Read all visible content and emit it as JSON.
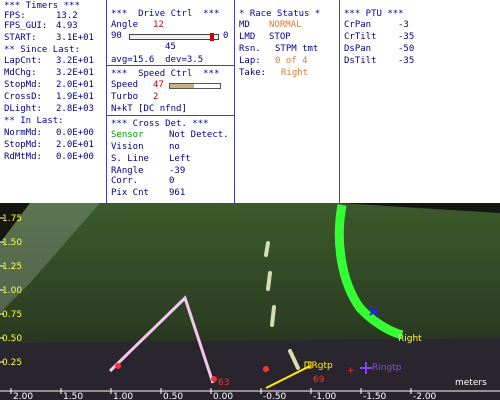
{
  "timers": {
    "title": "*** Timers ***",
    "fps_label": "FPS:",
    "fps": "13.2",
    "fpsgui_label": "FPS_GUI:",
    "fpsgui": "4.93",
    "start_label": "START:",
    "start": "3.1E+01",
    "since_last": "** Since Last:",
    "lapcnt_label": "LapCnt:",
    "lapcnt": "3.2E+01",
    "mdchg_label": "MdChg:",
    "mdchg": "3.2E+01",
    "stopmd_label": "StopMd:",
    "stopmd": "2.0E+01",
    "crossd_label": "CrossD:",
    "crossd": "1.9E+01",
    "dlight_label": "DLight:",
    "dlight": "2.8E+03",
    "in_last": "** In Last:",
    "normmd_label": "NormMd:",
    "normmd": "0.0E+00",
    "stopmd2_label": "StopMd:",
    "stopmd2": "2.0E+01",
    "rdmtmd_label": "RdMtMd:",
    "rdmtmd": "0.0E+00"
  },
  "drive": {
    "title": "***  Drive Ctrl  ***",
    "angle_label": "Angle",
    "angle": "12",
    "slider_min": "90",
    "slider_max": "0",
    "slider_mid": "45",
    "slider_level": 0.93,
    "avg": "avg=15.6  dev=3.5",
    "speed_title": "***  Speed Ctrl  ***",
    "speed_label": "Speed",
    "speed": "47",
    "speed_level": 0.47,
    "turbo_label": "Turbo",
    "turbo": "2",
    "nkt": "N+kT [DC nfnd]",
    "cross_title": "*** Cross Det. ***",
    "sensor_label": "Sensor",
    "sensor": "Not Detect.",
    "vision_label": "Vision",
    "vision": "no",
    "sline_label": "S. Line",
    "sline": "Left",
    "rangle_label": "RAngle",
    "rangle": "-39",
    "corr_label": "Corr.",
    "corr": "0",
    "pixcnt_label": "Pix Cnt",
    "pixcnt": "961"
  },
  "race": {
    "title": "* Race Status *",
    "md_label": "MD",
    "md": "NORMAL",
    "lmd_label": "LMD",
    "lmd": "STOP",
    "rsn_label": "Rsn.",
    "rsn": "STPM tmt",
    "lap_label": "Lap:",
    "lap": "0 of 4",
    "take_label": "Take:",
    "take": "Right"
  },
  "ptu": {
    "title": "*** PTU ***",
    "crpan_label": "CrPan",
    "crpan": "-3",
    "crtilt_label": "CrTilt",
    "crtilt": "-35",
    "dspan_label": "DsPan",
    "dspan": "-50",
    "dstilt_label": "DsTilt",
    "dstilt": "-35"
  },
  "camera": {
    "y_ticks": [
      "1.75",
      "1.50",
      "1.25",
      "1.00",
      "0.75",
      "0.50",
      "0.25"
    ],
    "x_ticks": [
      "2.00",
      "1.50",
      "1.00",
      "0.50",
      "0.00",
      "-0.50",
      "-1.00",
      "-1.50",
      "-2.00"
    ],
    "unit": "meters",
    "right_label": "Right",
    "trgtp_label": "TRgtp",
    "ringtp_label": "Ringtp",
    "m63": "63",
    "m69": "69"
  },
  "colors": {
    "panel_text": "#00008b",
    "value_red": "#d00000",
    "value_orange": "#e07a30",
    "sensor_green": "#00a000",
    "lane_green": "#33ff33"
  }
}
